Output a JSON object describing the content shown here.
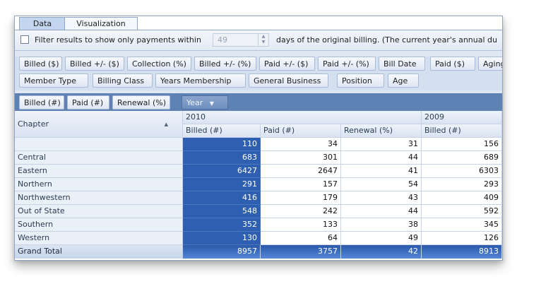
{
  "tabs": [
    {
      "label": "Data"
    },
    {
      "label": "Visualization"
    }
  ],
  "filter": {
    "prefix": "Filter results to show only payments within",
    "days_value": "49",
    "suffix": "days of the original billing.  (The current year's annual du"
  },
  "field_row_1": [
    "Billed ($)",
    "Billed +/- ($)",
    "Collection (%)",
    "Billed +/- (%)",
    "Paid +/- ($)",
    "Paid +/- (%)",
    "Bill Date",
    "Paid ($)",
    "Aging"
  ],
  "field_row_2": [
    "Member Type",
    "Billing Class",
    "Years Membership",
    "General Business",
    "Position",
    "Age"
  ],
  "data_fields": [
    "Billed (#)",
    "Paid (#)",
    "Renewal (%)"
  ],
  "column_field": {
    "label": "Year",
    "arrow": "▼"
  },
  "grid": {
    "row_header": "Chapter",
    "sort_arrow": "▲",
    "years": [
      "2010",
      "2009"
    ],
    "columns": [
      "Billed (#)",
      "Paid (#)",
      "Renewal (%)",
      "Billed (#)"
    ],
    "rows": [
      {
        "label": "",
        "values": [
          "110",
          "34",
          "31",
          "156"
        ]
      },
      {
        "label": "Central",
        "values": [
          "683",
          "301",
          "44",
          "689"
        ]
      },
      {
        "label": "Eastern",
        "values": [
          "6427",
          "2647",
          "41",
          "6303"
        ]
      },
      {
        "label": "Northern",
        "values": [
          "291",
          "157",
          "54",
          "293"
        ]
      },
      {
        "label": "Northwestern",
        "values": [
          "416",
          "179",
          "43",
          "409"
        ]
      },
      {
        "label": "Out of State",
        "values": [
          "548",
          "242",
          "44",
          "592"
        ]
      },
      {
        "label": "Southern",
        "values": [
          "352",
          "133",
          "38",
          "345"
        ]
      },
      {
        "label": "Western",
        "values": [
          "130",
          "64",
          "49",
          "126"
        ]
      }
    ],
    "total": {
      "label": "Grand Total",
      "values": [
        "8957",
        "3757",
        "42",
        "8913"
      ]
    }
  },
  "colors": {
    "selected_column": "#2e5fb0",
    "band": "#5f82b4",
    "tab_active": "#c4d5ee"
  }
}
